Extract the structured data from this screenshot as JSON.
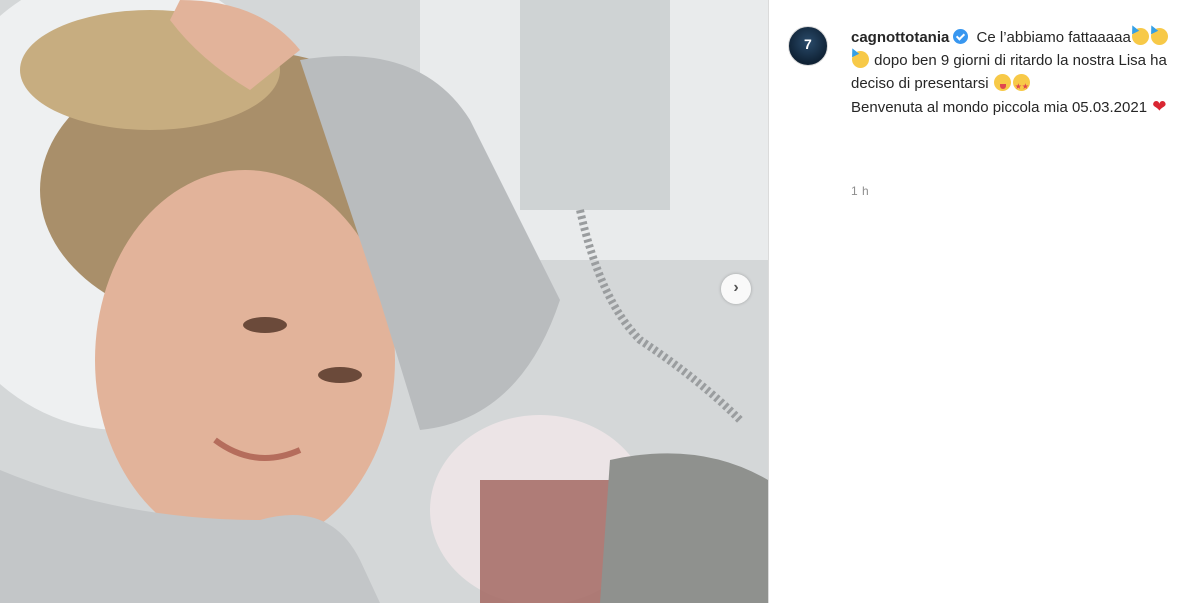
{
  "post": {
    "image_alt": "Photo of a mother lying in a hospital bed with her newborn baby",
    "next_icon": "chevron-right-icon",
    "next_glyph": "›"
  },
  "author": {
    "username": "cagnottotania",
    "verified_icon": "verified-badge-icon",
    "avatar_glyph": "7"
  },
  "caption": {
    "part1": "Ce l’abbiamo fattaaaaa",
    "emoji1": "partying-face-emoji",
    "part2": " dopo ben 9 giorni di ritardo la nostra Lisa ha deciso di presentarsi ",
    "emoji2": "zany-face-emoji",
    "emoji3": "star-struck-emoji",
    "part3": "Benvenuta al mondo piccola mia 05.03.2021 ",
    "emoji4": "heart-emoji",
    "heart_glyph": "❤"
  },
  "timestamp": "1 h",
  "colors": {
    "verified": "#3897f0",
    "username": "#262626",
    "timestamp": "#8e8e8e",
    "heart": "#d92632"
  }
}
